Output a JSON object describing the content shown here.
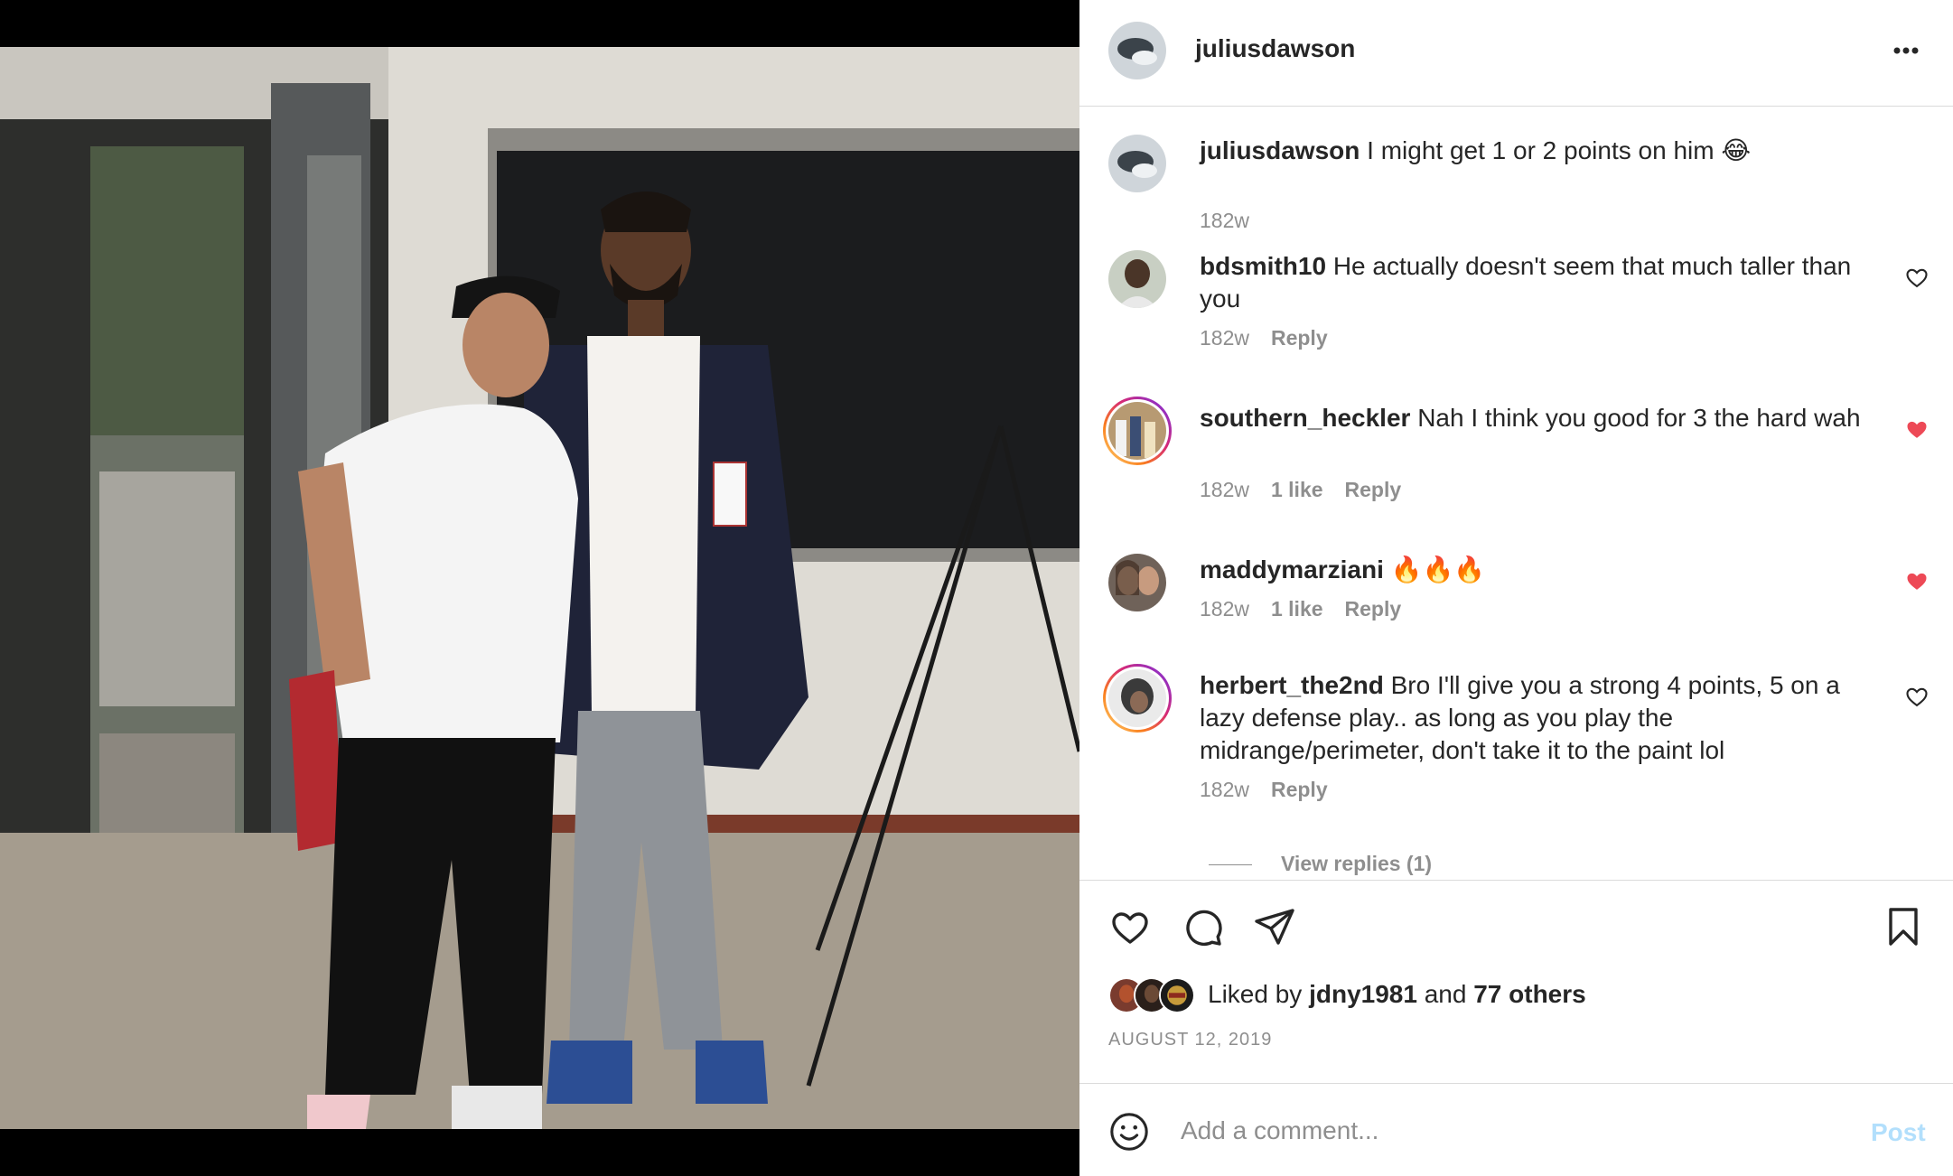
{
  "post": {
    "username": "juliusdawson",
    "more_icon": "more-horizontal-icon",
    "caption": {
      "username": "juliusdawson",
      "text": "I might get 1 or 2 points on him 😂",
      "time": "182w"
    },
    "comments": [
      {
        "username": "bdsmith10",
        "text": "He actually doesn't seem that much taller than you",
        "time": "182w",
        "likes": "",
        "reply": "Reply",
        "liked": false
      },
      {
        "username": "southern_heckler",
        "text": "Nah I think you good for 3 the hard wah",
        "time": "182w",
        "likes": "1 like",
        "reply": "Reply",
        "liked": true
      },
      {
        "username": "maddymarziani",
        "text": "🔥🔥🔥",
        "time": "182w",
        "likes": "1 like",
        "reply": "Reply",
        "liked": true
      },
      {
        "username": "herbert_the2nd",
        "text": "Bro I'll give you a strong 4 points, 5 on a lazy defense play.. as long as you play the midrange/perimeter, don't take it to the paint lol",
        "time": "182w",
        "likes": "",
        "reply": "Reply",
        "liked": false
      }
    ],
    "view_replies": "View replies (1)",
    "likes_prefix": "Liked by",
    "liked_by_user": "jdny1981",
    "likes_and": "and",
    "likes_others": "77 others",
    "date": "AUGUST 12, 2019",
    "comment_placeholder": "Add a comment...",
    "post_button": "Post",
    "colors": {
      "liked_heart": "#ed4956",
      "post_button_disabled": "#b2dffc",
      "secondary_text": "#8e8e8e",
      "divider": "#dbdbdb"
    }
  }
}
